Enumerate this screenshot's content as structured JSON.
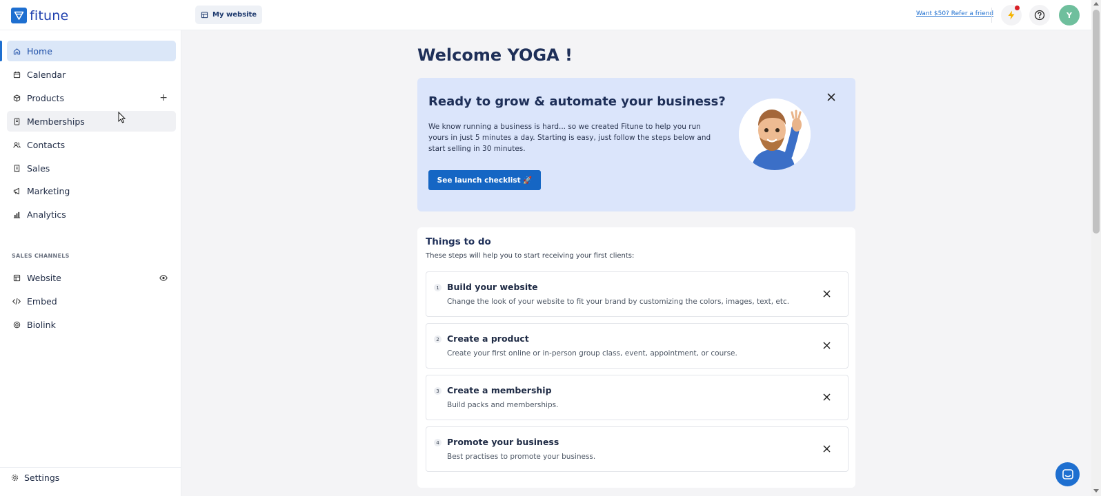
{
  "app": {
    "logo_text": "fitune"
  },
  "topbar": {
    "my_website_label": "My website",
    "refer_link": "Want $50? Refer a friend",
    "avatar_initial": "Y"
  },
  "sidebar": {
    "items": [
      {
        "label": "Home",
        "icon": "home-icon",
        "active": true
      },
      {
        "label": "Calendar",
        "icon": "calendar-icon"
      },
      {
        "label": "Products",
        "icon": "box-icon"
      },
      {
        "label": "Memberships",
        "icon": "card-icon"
      },
      {
        "label": "Contacts",
        "icon": "contacts-icon"
      },
      {
        "label": "Sales",
        "icon": "receipt-icon"
      },
      {
        "label": "Marketing",
        "icon": "megaphone-icon"
      },
      {
        "label": "Analytics",
        "icon": "chart-icon"
      }
    ],
    "sales_channels_label": "SALES CHANNELS",
    "channels": [
      {
        "label": "Website",
        "icon": "store-icon"
      },
      {
        "label": "Embed",
        "icon": "code-icon"
      },
      {
        "label": "Biolink",
        "icon": "link-icon"
      }
    ],
    "settings_label": "Settings"
  },
  "main": {
    "welcome": "Welcome YOGA !",
    "banner": {
      "title": "Ready to grow & automate your business?",
      "text": "We know running a business is hard... so we created Fitune to help you run yours in just 5 minutes a day. Starting is easy, just follow the steps below and start selling in 30 minutes.",
      "button_label": "See launch checklist 🚀"
    },
    "todo": {
      "title": "Things to do",
      "subtitle": "These steps will help you to start receiving your first clients:",
      "tasks": [
        {
          "num": "1",
          "title": "Build your website",
          "desc": "Change the look of your website to fit your brand by customizing the colors, images, text, etc."
        },
        {
          "num": "2",
          "title": "Create a product",
          "desc": "Create your first online or in-person group class, event, appointment, or course."
        },
        {
          "num": "3",
          "title": "Create a membership",
          "desc": "Build packs and memberships."
        },
        {
          "num": "4",
          "title": "Promote your business",
          "desc": "Best practises to promote your business."
        }
      ]
    }
  },
  "colors": {
    "accent": "#1e6fd0",
    "banner_bg": "#dbe5fb",
    "active_nav": "#dbe7f8",
    "notif": "#d81f26",
    "avatar": "#6fbf9d"
  }
}
